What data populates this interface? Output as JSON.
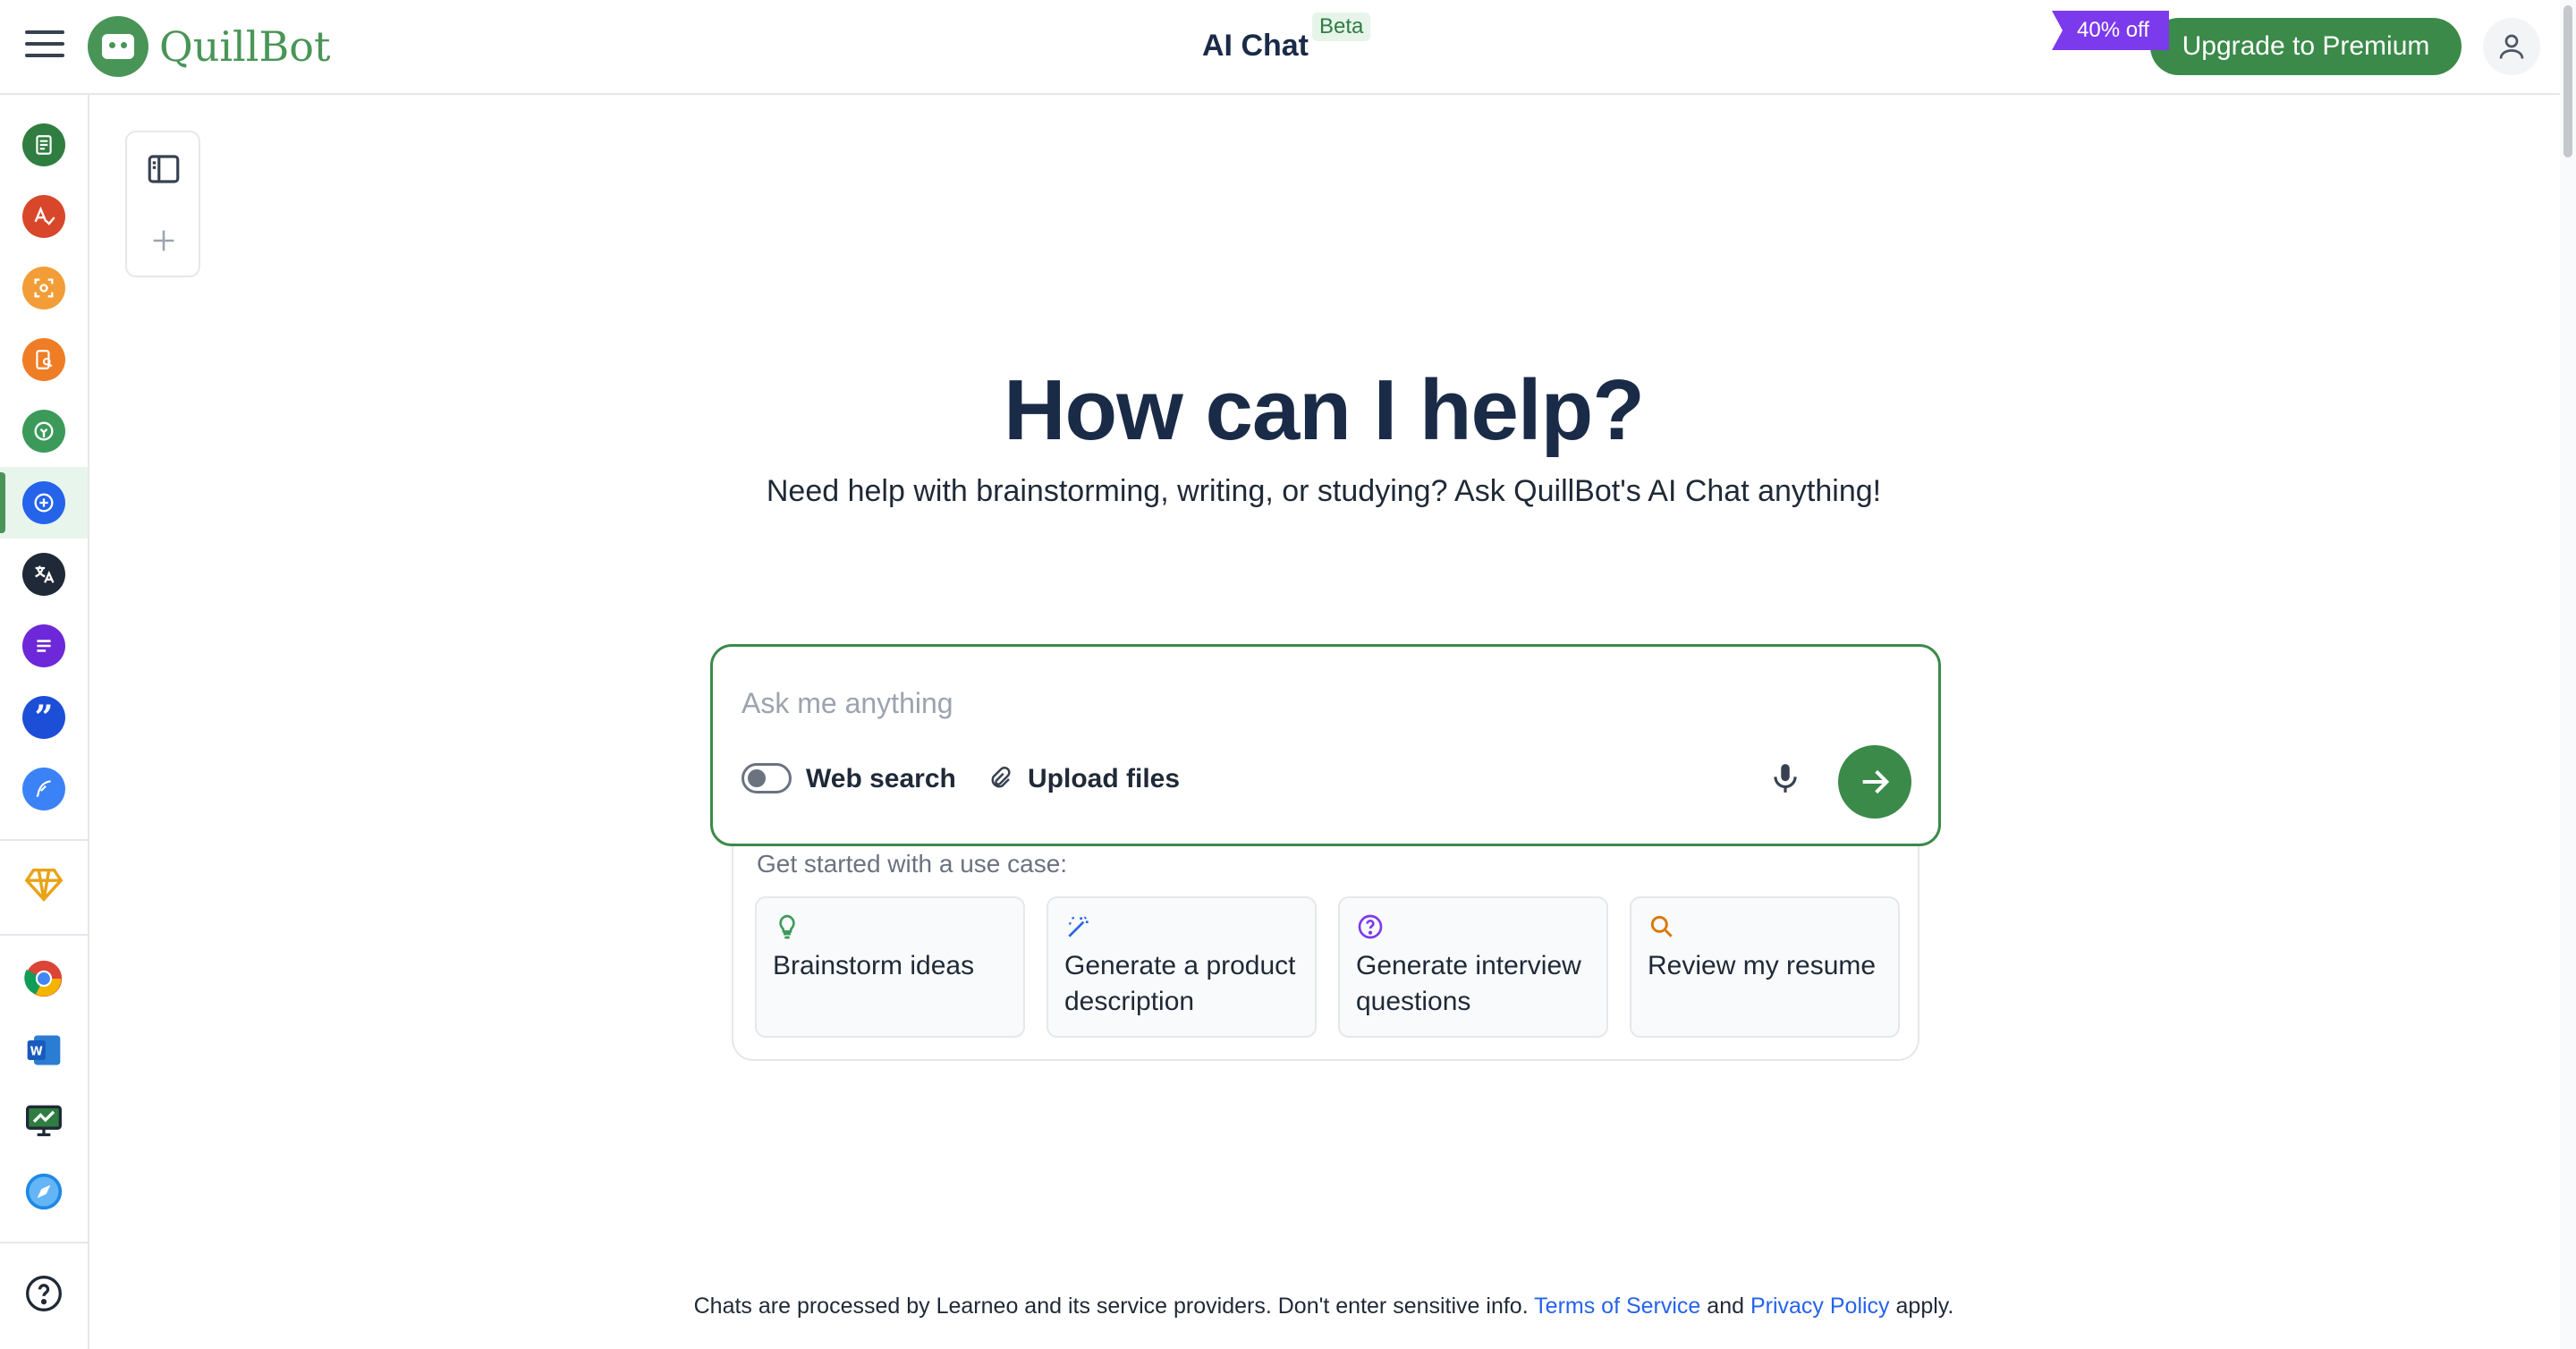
{
  "header": {
    "logo_text": "QuillBot",
    "app_title": "AI Chat",
    "beta_label": "Beta",
    "promo_badge": "40% off",
    "upgrade_label": "Upgrade to Premium"
  },
  "sidebar": {
    "items": [
      {
        "name": "paraphraser",
        "color": "#2f7d40"
      },
      {
        "name": "grammar-checker",
        "color": "#d9472b"
      },
      {
        "name": "ai-detector",
        "color": "#f29d38"
      },
      {
        "name": "plagiarism-checker",
        "color": "#ee7d25"
      },
      {
        "name": "ai-humanizer",
        "color": "#3b9a5a"
      },
      {
        "name": "ai-chat",
        "color": "#2563eb"
      },
      {
        "name": "translator",
        "color": "#1f2937"
      },
      {
        "name": "summarizer",
        "color": "#6d28d9"
      },
      {
        "name": "citation-generator",
        "color": "#1d4ed8"
      },
      {
        "name": "flow",
        "color": "#3b82f6"
      }
    ],
    "premium_color": "#e8a317",
    "bottom_items": [
      "chrome-extension",
      "word-addin",
      "desktop-app",
      "safari-extension"
    ]
  },
  "hero": {
    "title": "How can I help?",
    "subtitle": "Need help with brainstorming, writing, or studying? Ask QuillBot's AI Chat anything!"
  },
  "chat": {
    "placeholder": "Ask me anything",
    "web_search_label": "Web search",
    "upload_label": "Upload files"
  },
  "use_cases": {
    "title": "Get started with a use case:",
    "cards": [
      {
        "label": "Brainstorm ideas",
        "icon": "lightbulb-icon",
        "color": "#3b9a5a"
      },
      {
        "label": "Generate a product description",
        "icon": "magic-wand-icon",
        "color": "#2563eb"
      },
      {
        "label": "Generate interview questions",
        "icon": "question-circle-icon",
        "color": "#7c3aed"
      },
      {
        "label": "Review my resume",
        "icon": "search-icon",
        "color": "#d97706"
      }
    ]
  },
  "footer": {
    "text_before": "Chats are processed by Learneo and its service providers. Don't enter sensitive info.",
    "terms_label": "Terms of Service",
    "and_text": "and",
    "privacy_label": "Privacy Policy",
    "text_after": "apply."
  }
}
